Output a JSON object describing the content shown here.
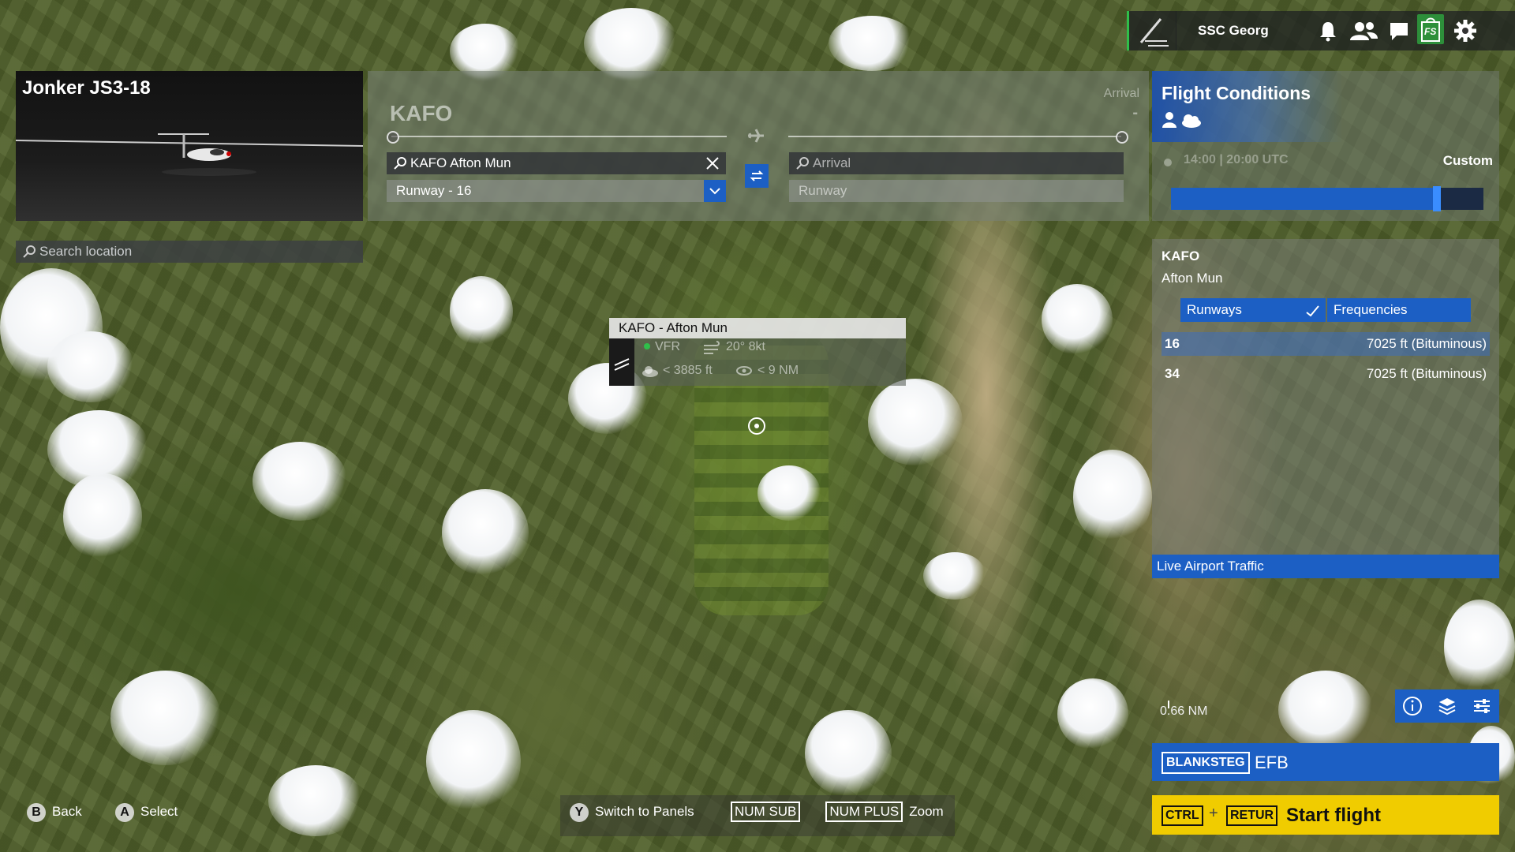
{
  "topbar": {
    "username": "SSC Georg",
    "icons": [
      "logbook-icon",
      "bell-icon",
      "friends-icon",
      "chat-icon",
      "marketplace-icon",
      "settings-icon"
    ],
    "shop_label": "FS"
  },
  "aircraft": {
    "title": "Jonker JS3-18"
  },
  "search_location": {
    "placeholder": "Search location"
  },
  "route": {
    "departure_code": "KAFO",
    "arrival_label": "Arrival",
    "arrival_code": "-",
    "departure_search": "KAFO Afton Mun",
    "departure_runway": "Runway - 16",
    "arrival_search_placeholder": "Arrival",
    "arrival_runway_placeholder": "Runway"
  },
  "conditions": {
    "title": "Flight Conditions",
    "time_text": "14:00 | 20:00 UTC",
    "preset": "Custom",
    "time_of_day_fraction": 0.85
  },
  "airport": {
    "icao": "KAFO",
    "name": "Afton Mun",
    "tabs": [
      "Runways",
      "Frequencies"
    ],
    "runways": [
      {
        "number": "16",
        "length": "7025 ft (Bituminous)"
      },
      {
        "number": "34",
        "length": "7025 ft (Bituminous)"
      }
    ],
    "live_traffic": "Live Airport Traffic"
  },
  "popup": {
    "title": "KAFO - Afton Mun",
    "flight_rules": "VFR",
    "wind": "20° 8kt",
    "ceiling": "< 3885 ft",
    "visibility": "< 9 NM"
  },
  "map": {
    "scale": "0.66 NM"
  },
  "efb": {
    "key": "BLANKSTEG",
    "label": "EFB"
  },
  "start_flight": {
    "key1": "CTRL",
    "plus": "+",
    "key2": "RETUR",
    "label": "Start flight"
  },
  "hints": {
    "back_key": "B",
    "back": "Back",
    "select_key": "A",
    "select": "Select",
    "panels_key": "Y",
    "panels": "Switch to Panels",
    "zoom_out_key": "NUM SUB",
    "zoom_in_key": "NUM PLUS",
    "zoom": "Zoom"
  },
  "colors": {
    "accent": "#1c5fc4",
    "start_flight": "#f0cc00",
    "shop": "#2d8f3a"
  }
}
